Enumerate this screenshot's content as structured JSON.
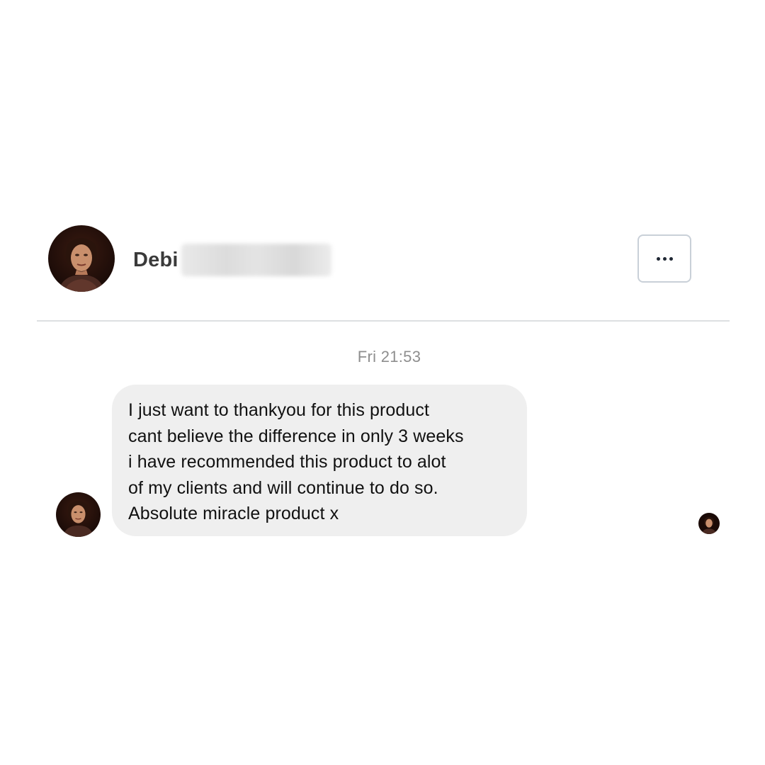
{
  "header": {
    "contact_first_name": "Debi",
    "avatar_icon": "profile-photo",
    "more_icon": "ellipsis-icon"
  },
  "conversation": {
    "timestamp": "Fri 21:53",
    "messages": [
      {
        "lines": [
          "I just want to thankyou for this product",
          "cant believe the difference in only 3 weeks",
          "i have recommended this product to alot",
          "of my clients and will continue to do so.",
          "Absolute miracle product x"
        ]
      }
    ]
  },
  "colors": {
    "bubble_background": "#efefef",
    "divider": "#dddfe2",
    "timestamp_text": "#8e8e8e",
    "name_text": "#3a3a3a"
  }
}
